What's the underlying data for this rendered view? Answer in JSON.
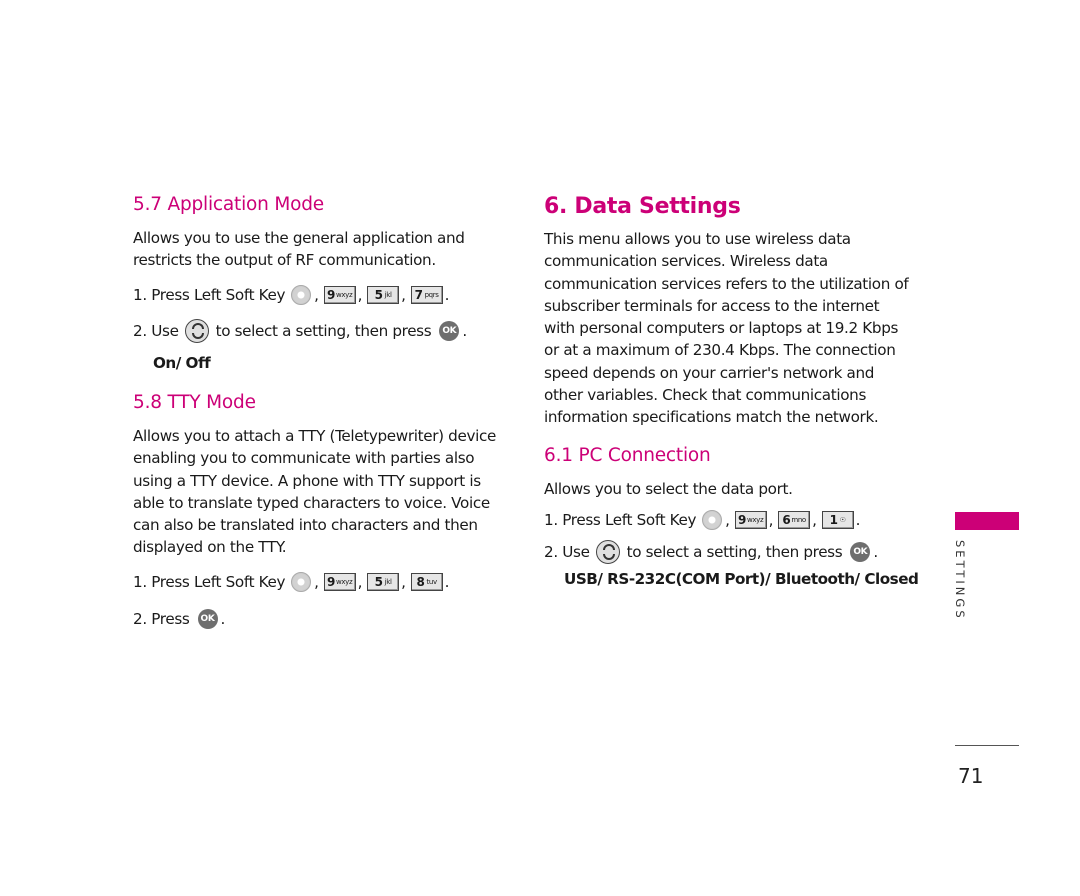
{
  "left": {
    "app_mode": {
      "heading": "5.7 Application Mode",
      "description": "Allows you to use the general application and restricts the output of RF communication.",
      "step1_text": "1. Press Left Soft Key",
      "step1_keys": [
        {
          "main": "9",
          "sub": "wxyz"
        },
        {
          "main": "5",
          "sub": "jkl"
        },
        {
          "main": "7",
          "sub": "pqrs"
        }
      ],
      "step2_prefix": "2. Use",
      "step2_text": "to select a setting, then press",
      "ok_label": "OK",
      "options": "On/ Off"
    },
    "tty_mode": {
      "heading": "5.8 TTY Mode",
      "description": "Allows you to attach a TTY (Teletypewriter) device enabling you to communicate with parties also using a TTY device. A phone with TTY support is able to translate typed characters to voice. Voice can also be translated into characters and then displayed on the TTY.",
      "step1_text": "1. Press Left Soft Key",
      "step1_keys": [
        {
          "main": "9",
          "sub": "wxyz"
        },
        {
          "main": "5",
          "sub": "jkl"
        },
        {
          "main": "8",
          "sub": "tuv"
        }
      ],
      "step2_text": "2. Press",
      "ok_label": "OK"
    }
  },
  "right": {
    "data_settings": {
      "heading": "6. Data Settings",
      "description": "This menu allows you to use wireless data communication services. Wireless data communication services refers to the utilization of subscriber terminals for access to the internet with personal computers or laptops at 19.2 Kbps or at a maximum of 230.4 Kbps. The connection speed depends on your carrier's network and other variables. Check that communications information specifications match the network."
    },
    "pc_connection": {
      "heading": "6.1 PC Connection",
      "description": "Allows you to select the data port.",
      "step1_text": "1. Press Left Soft Key",
      "step1_keys": [
        {
          "main": "9",
          "sub": "wxyz"
        },
        {
          "main": "6",
          "sub": "mno"
        },
        {
          "main": "1",
          "sub": "voicemail"
        }
      ],
      "step2_prefix": "2. Use",
      "step2_text": "to select a setting, then press",
      "ok_label": "OK",
      "options": "USB/ RS-232C(COM Port)/ Bluetooth/ Closed"
    }
  },
  "sidebar": {
    "section_label": "SETTINGS",
    "accent_color": "#cc0077"
  },
  "page_number": "71",
  "separators": {
    "comma": ",",
    "period": "."
  }
}
